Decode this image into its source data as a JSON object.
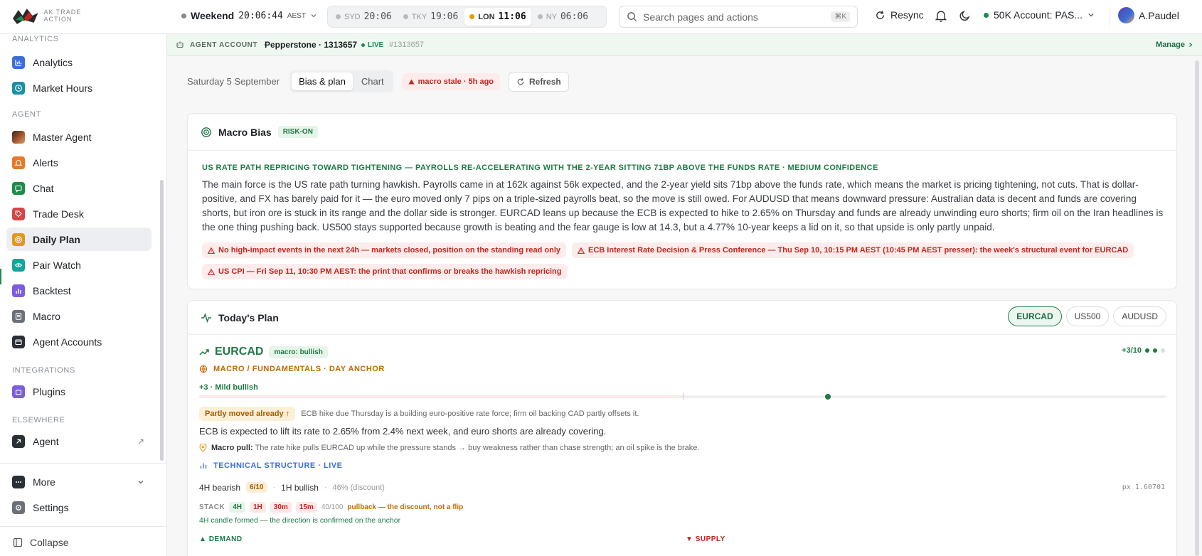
{
  "header": {
    "logo_text": "AK TRADE ACTION",
    "market_state": "Weekend",
    "time": "20:06:44",
    "timezone": "AEST",
    "sessions": [
      {
        "code": "SYD",
        "time": "20:06",
        "active": false
      },
      {
        "code": "TKY",
        "time": "19:06",
        "active": false
      },
      {
        "code": "LON",
        "time": "11:06",
        "active": true
      },
      {
        "code": "NY",
        "time": "06:06",
        "active": false
      }
    ],
    "search_placeholder": "Search pages and actions",
    "search_shortcut": "⌘K",
    "resync_label": "Resync",
    "account_label": "50K Account: PAS...",
    "user_name": "A.Paudel"
  },
  "sidebar": {
    "sections": {
      "analytics": "ANALYTICS",
      "agent": "AGENT",
      "integrations": "INTEGRATIONS",
      "elsewhere": "ELSEWHERE"
    },
    "items": [
      {
        "label": "Analytics",
        "icon": "chart-icon",
        "color": "#3b6fd8"
      },
      {
        "label": "Market Hours",
        "icon": "clock-icon",
        "color": "#1d8fa3"
      },
      {
        "label": "Master Agent",
        "icon": "agent-avatar-icon",
        "color": "#6b3a2a"
      },
      {
        "label": "Alerts",
        "icon": "bell-icon",
        "color": "#e8782a"
      },
      {
        "label": "Chat",
        "icon": "chat-icon",
        "color": "#1f8a4c"
      },
      {
        "label": "Trade Desk",
        "icon": "tag-icon",
        "color": "#d64545"
      },
      {
        "label": "Daily Plan",
        "icon": "target-icon",
        "color": "#e09a1a"
      },
      {
        "label": "Pair Watch",
        "icon": "eye-icon",
        "color": "#16a39b"
      },
      {
        "label": "Backtest",
        "icon": "bars-icon",
        "color": "#7d5ce0"
      },
      {
        "label": "Macro",
        "icon": "document-icon",
        "color": "#6b7078"
      },
      {
        "label": "Agent Accounts",
        "icon": "wallet-icon",
        "color": "#2b2f36"
      },
      {
        "label": "Plugins",
        "icon": "puzzle-icon",
        "color": "#7d5ce0"
      },
      {
        "label": "Agent",
        "icon": "arrow-icon",
        "color": "#2b2f36"
      }
    ],
    "more_label": "More",
    "settings_label": "Settings",
    "collapse_label": "Collapse"
  },
  "agent_bar": {
    "label": "AGENT ACCOUNT",
    "broker": "Pepperstone · 1313657",
    "status": "LIVE",
    "id": "#1313657",
    "manage": "Manage"
  },
  "controls": {
    "date": "Saturday 5 September",
    "tabs": [
      "Bias & plan",
      "Chart"
    ],
    "stale": "macro stale · 5h ago",
    "refresh": "Refresh"
  },
  "macro_bias": {
    "title": "Macro Bias",
    "badge": "RISK-ON",
    "headline": "US RATE PATH REPRICING TOWARD TIGHTENING — PAYROLLS RE-ACCELERATING WITH THE 2-YEAR SITTING 71BP ABOVE THE FUNDS RATE · MEDIUM CONFIDENCE",
    "body": "The main force is the US rate path turning hawkish. Payrolls came in at 162k against 56k expected, and the 2-year yield sits 71bp above the funds rate, which means the market is pricing tightening, not cuts. That is dollar-positive, and FX has barely paid for it — the euro moved only 7 pips on a triple-sized payrolls beat, so the move is still owed. For AUDUSD that means downward pressure: Australian data is decent and funds are covering shorts, but iron ore is stuck in its range and the dollar side is stronger. EURCAD leans up because the ECB is expected to hike to 2.65% on Thursday and funds are already unwinding euro shorts; firm oil on the Iran headlines is the one thing pushing back. US500 stays supported because growth is beating and the fear gauge is low at 14.3, but a 4.77% 10-year keeps a lid on it, so that upside is only partly unpaid.",
    "events": [
      "No high-impact events in the next 24h — markets closed, position on the standing read only",
      "ECB Interest Rate Decision & Press Conference — Thu Sep 10, 10:15 PM AEST (10:45 PM AEST presser): the week's structural event for EURCAD",
      "US CPI — Fri Sep 11, 10:30 PM AEST: the print that confirms or breaks the hawkish repricing"
    ]
  },
  "plan": {
    "title": "Today's Plan",
    "pairs": [
      "EURCAD",
      "US500",
      "AUDUSD"
    ],
    "symbol": "EURCAD",
    "macro_tag": "macro: bullish",
    "score": "+3/10",
    "score_fraction": 0.3,
    "macro_header": "MACRO / FUNDAMENTALS · DAY ANCHOR",
    "mild": "+3 · Mild bullish",
    "moved_badge": "Partly moved already ↑",
    "moved_note": "ECB hike due Thursday is a building euro-positive rate force; firm oil backing CAD partly offsets it.",
    "ecb_line": "ECB is expected to lift its rate to 2.65% from 2.4% next week, and euro shorts are already covering.",
    "pull_label": "Macro pull:",
    "pull_text": "The rate hike pulls EURCAD up while the pressure stands → buy weakness rather than chase strength; an oil spike is the brake.",
    "tech_header": "TECHNICAL STRUCTURE · LIVE",
    "tf4h": "4H bearish",
    "tf4h_score": "6/10",
    "tf1h": "1H bullish",
    "discount": "46% (discount)",
    "px": "px 1.60701",
    "stack_label": "STACK",
    "stack": [
      {
        "tf": "4H",
        "dir": "up"
      },
      {
        "tf": "1H",
        "dir": "down"
      },
      {
        "tf": "30m",
        "dir": "down"
      },
      {
        "tf": "15m",
        "dir": "down"
      }
    ],
    "stack_score": "40/100",
    "stack_note": "pullback — the discount, not a flip",
    "confirm": "4H candle formed — the direction is confirmed on the anchor",
    "demand": "DEMAND",
    "supply": "SUPPLY"
  }
}
